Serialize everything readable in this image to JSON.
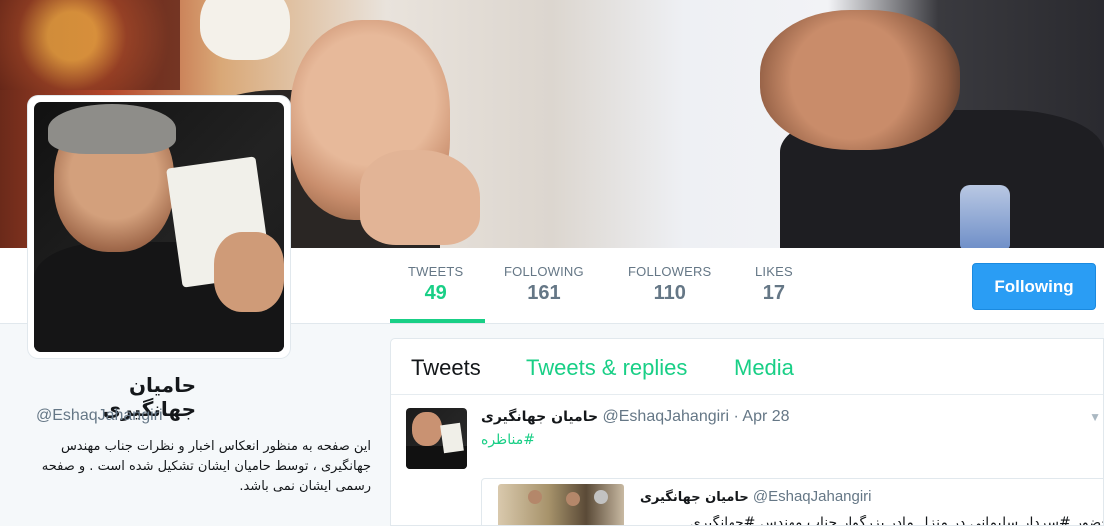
{
  "profile": {
    "name": "حامیان جهانگیری",
    "handle": "@EshaqJahangiri",
    "bio": "این صفحه به منظور انعکاس اخبار و نظرات جناب مهندس جهانگیری ، توسط حامیان ایشان تشکیل شده است . و صفحه رسمی ایشان نمی باشد."
  },
  "stats": [
    {
      "label": "TWEETS",
      "value": "49"
    },
    {
      "label": "FOLLOWING",
      "value": "161"
    },
    {
      "label": "FOLLOWERS",
      "value": "110"
    },
    {
      "label": "LIKES",
      "value": "17"
    }
  ],
  "follow_button": "Following",
  "tabs": [
    "Tweets",
    "Tweets & replies",
    "Media"
  ],
  "tweet": {
    "name": "حامیان جهانگیری",
    "handle": "@EshaqJahangiri",
    "separator": "·",
    "date": "Apr 28",
    "hashtag": "#مناظره",
    "quote": {
      "name": "حامیان جهانگیری",
      "handle": "@EshaqJahangiri",
      "text": "حضور #سردار سلیمانی در منزل مادر بزرگوار جناب مهندس #جهانگیری"
    }
  },
  "colors": {
    "accent": "#19cf86",
    "button": "#2a9df4"
  }
}
